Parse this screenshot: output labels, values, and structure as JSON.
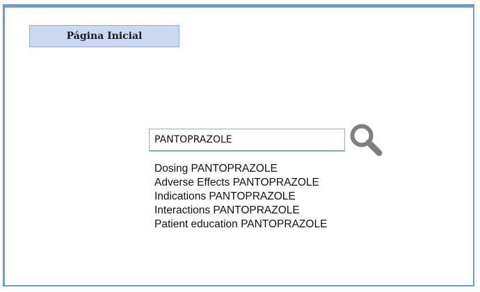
{
  "header": {
    "home_label": "Página Inicial"
  },
  "search": {
    "value": "PANTOPRAZOLE",
    "icon": "search-icon"
  },
  "suggestions": [
    "Dosing PANTOPRAZOLE",
    "Adverse Effects PANTOPRAZOLE",
    "Indications PANTOPRAZOLE",
    "Interactions PANTOPRAZOLE",
    "Patient education PANTOPRAZOLE"
  ],
  "colors": {
    "frame_border": "#6d9bd0",
    "button_bg": "#c8d9f1",
    "icon": "#7f7f7f"
  }
}
